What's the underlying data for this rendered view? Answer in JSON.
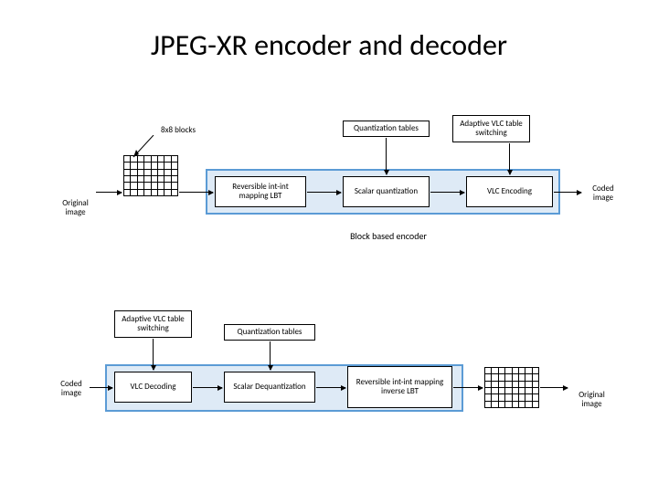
{
  "title": "JPEG-XR encoder and decoder",
  "encoder": {
    "blocks_label": "8x8 blocks",
    "qtables_label": "Quantization tables",
    "adaptive_vlc_label": "Adaptive VLC table switching",
    "original_image_label": "Original image",
    "stage1": "Reversible int-int mapping LBT",
    "stage2": "Scalar quantization",
    "stage3": "VLC Encoding",
    "coded_image_label": "Coded image",
    "group_label": "Block based encoder"
  },
  "decoder": {
    "adaptive_vlc_label": "Adaptive VLC table switching",
    "qtables_label": "Quantization tables",
    "coded_image_label": "Coded image",
    "stage1": "VLC Decoding",
    "stage2": "Scalar Dequantization",
    "stage3": "Reversible int-int mapping inverse LBT",
    "original_image_label": "Original image"
  }
}
